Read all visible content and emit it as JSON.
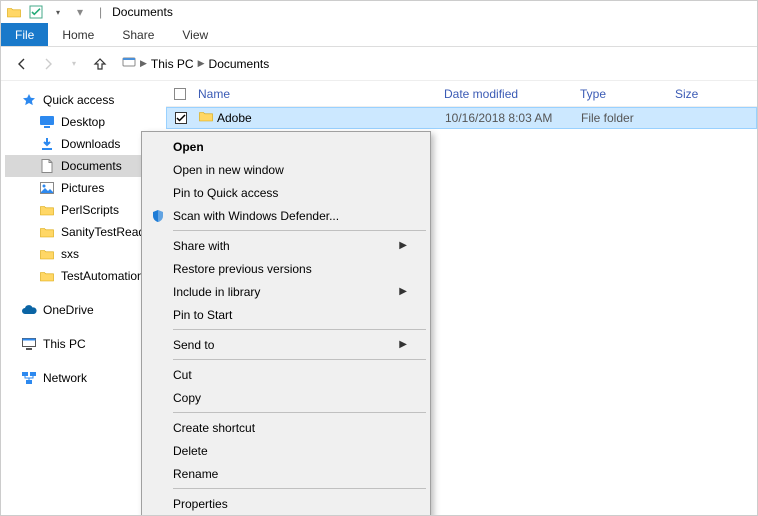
{
  "qat": {
    "title": "Documents"
  },
  "ribbon": {
    "file": "File",
    "tabs": [
      "Home",
      "Share",
      "View"
    ]
  },
  "breadcrumb": {
    "parts": [
      "This PC",
      "Documents"
    ]
  },
  "tree": {
    "quick_access": "Quick access",
    "items": [
      "Desktop",
      "Downloads",
      "Documents",
      "Pictures",
      "PerlScripts",
      "SanityTestReady",
      "sxs",
      "TestAutomation"
    ],
    "selected_index": 2,
    "onedrive": "OneDrive",
    "this_pc": "This PC",
    "network": "Network"
  },
  "columns": {
    "name": "Name",
    "date": "Date modified",
    "type": "Type",
    "size": "Size"
  },
  "rows": [
    {
      "name": "Adobe",
      "date": "10/16/2018 8:03 AM",
      "type": "File folder",
      "size": "",
      "checked": true,
      "selected": true
    }
  ],
  "context_menu": {
    "groups": [
      [
        {
          "label": "Open",
          "bold": true
        },
        {
          "label": "Open in new window"
        },
        {
          "label": "Pin to Quick access"
        },
        {
          "label": "Scan with Windows Defender...",
          "icon": "defender"
        }
      ],
      [
        {
          "label": "Share with",
          "submenu": true
        },
        {
          "label": "Restore previous versions"
        },
        {
          "label": "Include in library",
          "submenu": true
        },
        {
          "label": "Pin to Start"
        }
      ],
      [
        {
          "label": "Send to",
          "submenu": true
        }
      ],
      [
        {
          "label": "Cut"
        },
        {
          "label": "Copy"
        }
      ],
      [
        {
          "label": "Create shortcut"
        },
        {
          "label": "Delete"
        },
        {
          "label": "Rename"
        }
      ],
      [
        {
          "label": "Properties"
        }
      ]
    ]
  }
}
